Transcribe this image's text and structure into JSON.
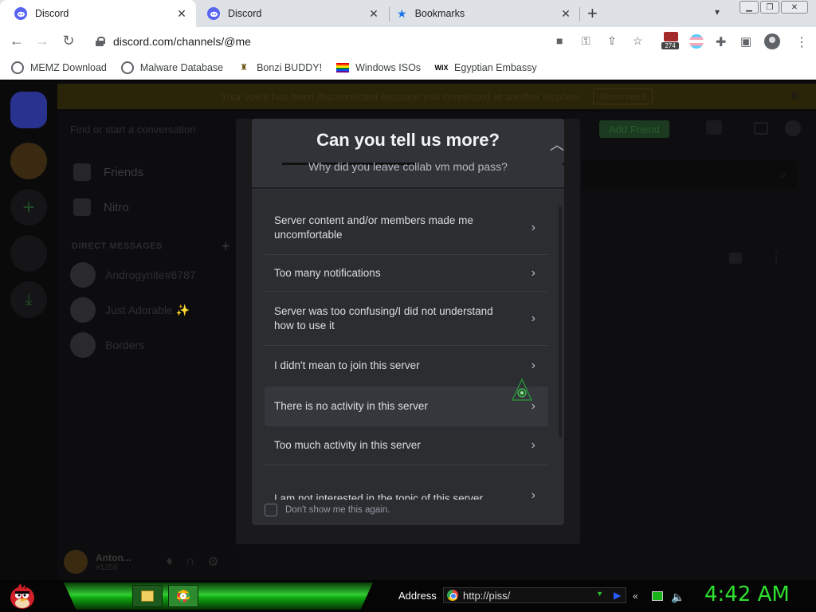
{
  "browser": {
    "tabs": [
      {
        "title": "Discord",
        "active": true,
        "favicon": "discord-icon"
      },
      {
        "title": "Discord",
        "active": false,
        "favicon": "discord-icon"
      },
      {
        "title": "Bookmarks",
        "active": false,
        "favicon": "star-icon"
      }
    ],
    "url": "discord.com/channels/@me",
    "extension_badge": "274",
    "bookmarks": [
      {
        "label": "MEMZ Download",
        "icon": "globe-icon"
      },
      {
        "label": "Malware Database",
        "icon": "globe-icon"
      },
      {
        "label": "Bonzi BUDDY!",
        "icon": "bonzi-icon"
      },
      {
        "label": "Windows ISOs",
        "icon": "rainbow-flag-icon"
      },
      {
        "label": "Egyptian Embassy",
        "icon": "wix-icon"
      }
    ]
  },
  "discord": {
    "banner_text": "Your voice has been disconnected because you connected at another location.",
    "banner_button": "Reconnect",
    "search_placeholder": "Find or start a conversation",
    "nav": [
      {
        "label": "Friends",
        "icon": "friends-icon"
      },
      {
        "label": "Nitro",
        "icon": "nitro-icon"
      }
    ],
    "dm_header": "DIRECT MESSAGES",
    "dms": [
      {
        "name": "Androgynite#6787"
      },
      {
        "name": "Just Adorable ✨"
      },
      {
        "name": "Borders"
      }
    ],
    "user": {
      "name": "Anton...",
      "tag": "#1256"
    },
    "add_friend": "Add Friend",
    "behind_dm_name": "Just Adorable ✨",
    "modal": {
      "title": "Can you tell us more?",
      "subtitle": "Why did you leave collab vm mod pass?",
      "options": [
        "Server content and/or members made me uncomfortable",
        "Too many notifications",
        "Server was too confusing/I did not understand how to use it",
        "I didn't mean to join this server",
        "There is no activity in this server",
        "Too much activity in this server",
        "I am not interested in the topic of this server"
      ],
      "hovered_option_index": 4,
      "dont_show_label": "Don't show me this again."
    }
  },
  "taskbar": {
    "address_label": "Address",
    "address_value": "http://piss/",
    "clock": "4:42 AM"
  },
  "colors": {
    "discord_blurple": "#5865f2",
    "modal_bg": "#2b2d31",
    "clock_green": "#2fe02f"
  }
}
